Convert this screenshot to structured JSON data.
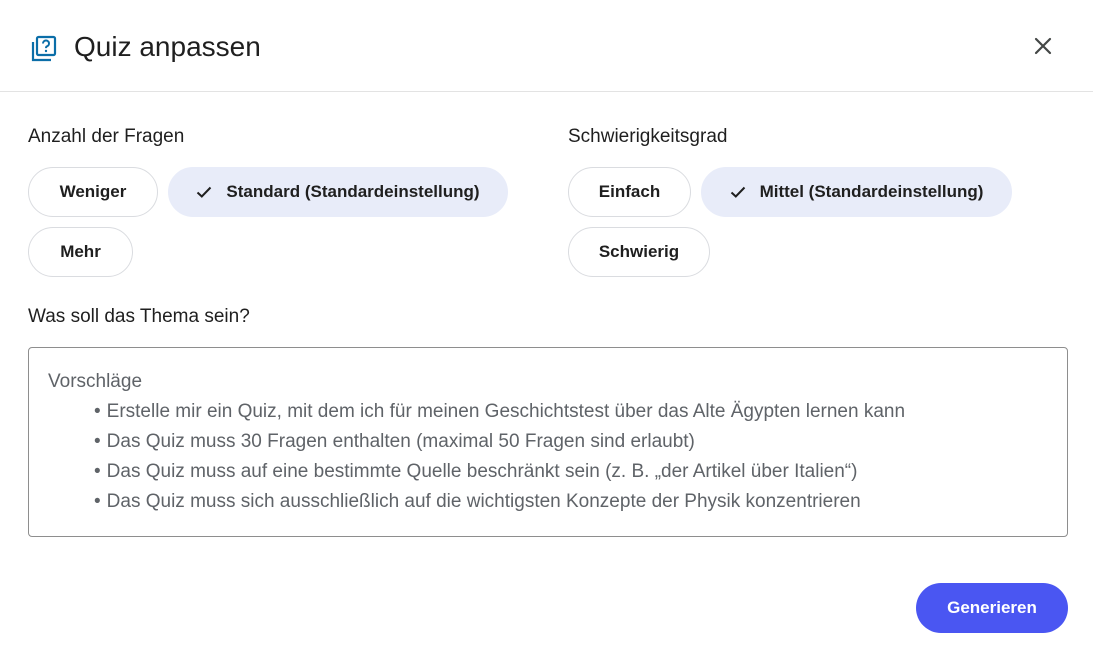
{
  "dialog": {
    "title": "Quiz anpassen",
    "icon": "quiz-icon",
    "close_icon": "close-icon"
  },
  "questions": {
    "label": "Anzahl der Fragen",
    "options": [
      {
        "label": "Weniger",
        "selected": false
      },
      {
        "label": "Standard (Standardeinstellung)",
        "selected": true
      },
      {
        "label": "Mehr",
        "selected": false
      }
    ]
  },
  "difficulty": {
    "label": "Schwierigkeitsgrad",
    "options": [
      {
        "label": "Einfach",
        "selected": false
      },
      {
        "label": "Mittel (Standardeinstellung)",
        "selected": true
      },
      {
        "label": "Schwierig",
        "selected": false
      }
    ]
  },
  "topic": {
    "label": "Was soll das Thema sein?",
    "value": "",
    "placeholder_title": "Vorschläge",
    "suggestions": [
      "Erstelle mir ein Quiz, mit dem ich für meinen Geschichtstest über das Alte Ägypten lernen kann",
      "Das Quiz muss 30 Fragen enthalten (maximal 50 Fragen sind erlaubt)",
      "Das Quiz muss auf eine bestimmte Quelle beschränkt sein (z. B. „der Artikel über Italien“)",
      "Das Quiz muss sich ausschließlich auf die wichtigsten Konzepte der Physik konzentrieren"
    ]
  },
  "actions": {
    "generate_label": "Generieren"
  },
  "colors": {
    "accent": "#4a56f2",
    "selected_chip": "#e8ecf9",
    "icon_blue": "#0b6ea8"
  }
}
